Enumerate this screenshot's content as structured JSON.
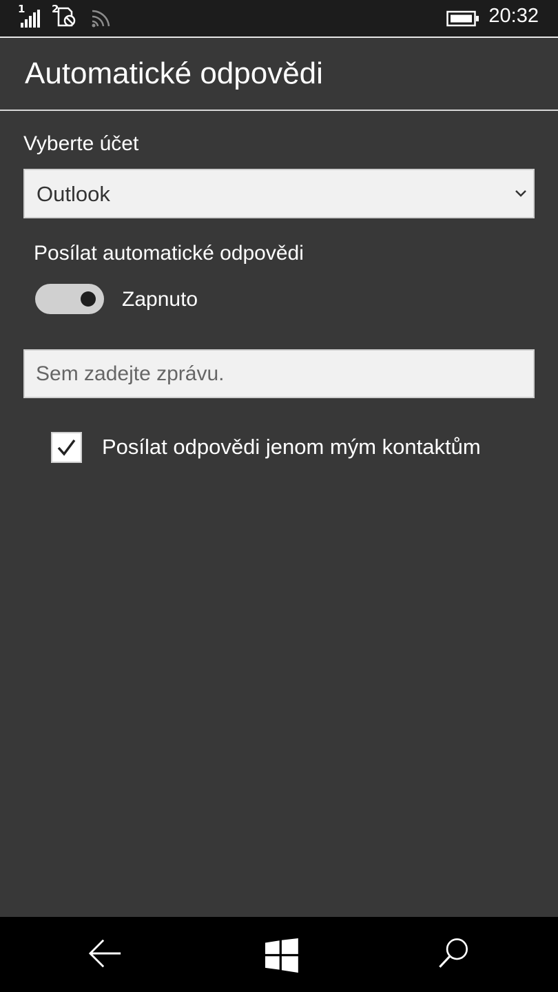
{
  "status_bar": {
    "sim1_label": "1",
    "sim2_label": "2",
    "time": "20:32",
    "icons": [
      "signal-bars-icon",
      "sim-no-service-icon",
      "wifi-icon",
      "battery-icon"
    ]
  },
  "header": {
    "title": "Automatické odpovědi"
  },
  "account": {
    "label": "Vyberte účet",
    "selected": "Outlook"
  },
  "auto_reply": {
    "label": "Posílat automatické odpovědi",
    "toggle_state_label": "Zapnuto",
    "enabled": true
  },
  "message": {
    "value": "",
    "placeholder": "Sem zadejte zprávu."
  },
  "contacts_only": {
    "label": "Posílat odpovědi jenom mým kontaktům",
    "checked": true
  },
  "navbar": {
    "icons": [
      "back-arrow-icon",
      "windows-start-icon",
      "search-icon"
    ]
  },
  "colors": {
    "background": "#383838",
    "status_bar": "#1c1c1c",
    "nav_bar": "#000000",
    "input_bg": "#f1f1f1",
    "toggle_track": "#d0d0d0"
  }
}
